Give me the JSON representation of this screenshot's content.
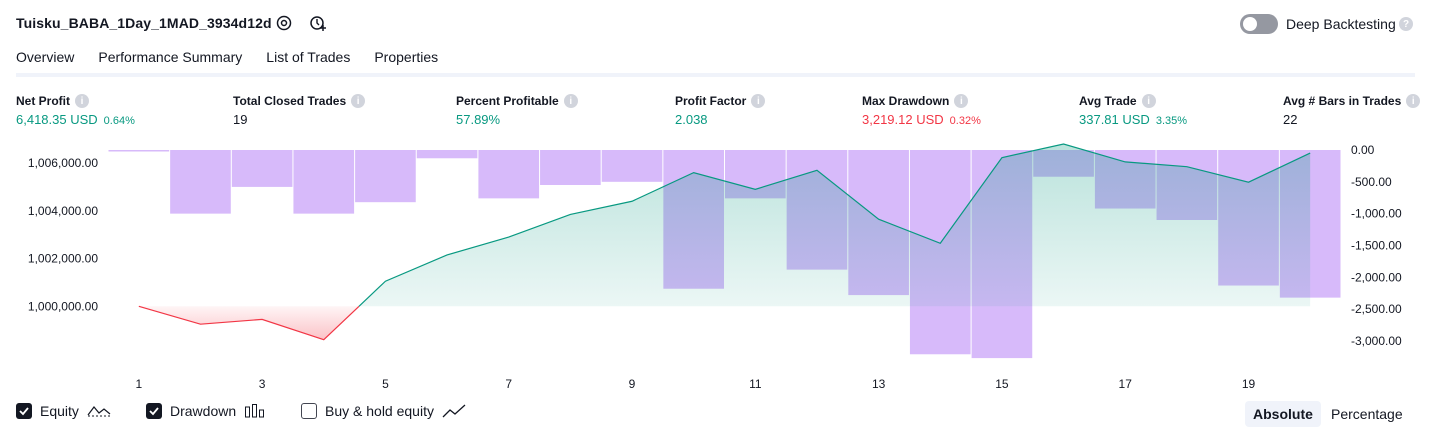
{
  "header": {
    "strategy_name": "Tuisku_BABA_1Day_1MAD_3934d12d",
    "settings_icon": "gear-icon",
    "alert_icon": "add-alert-icon",
    "deep_backtesting_label": "Deep Backtesting",
    "deep_backtesting_enabled": false,
    "help_glyph": "?"
  },
  "tabs": [
    {
      "label": "Overview",
      "active": true
    },
    {
      "label": "Performance Summary",
      "active": false
    },
    {
      "label": "List of Trades",
      "active": false
    },
    {
      "label": "Properties",
      "active": false
    }
  ],
  "metrics": [
    {
      "label": "Net Profit",
      "value": "6,418.35 USD",
      "pct": "0.64%",
      "color": "#089981"
    },
    {
      "label": "Total Closed Trades",
      "value": "19",
      "pct": "",
      "color": "#131722"
    },
    {
      "label": "Percent Profitable",
      "value": "57.89%",
      "pct": "",
      "color": "#089981"
    },
    {
      "label": "Profit Factor",
      "value": "2.038",
      "pct": "",
      "color": "#089981"
    },
    {
      "label": "Max Drawdown",
      "value": "3,219.12 USD",
      "pct": "0.32%",
      "color": "#f23645"
    },
    {
      "label": "Avg Trade",
      "value": "337.81 USD",
      "pct": "3.35%",
      "color": "#089981"
    },
    {
      "label": "Avg # Bars in Trades",
      "value": "22",
      "pct": "",
      "color": "#131722"
    }
  ],
  "info_glyph": "i",
  "chart_data": {
    "type": "line",
    "x": [
      1,
      2,
      3,
      4,
      5,
      6,
      7,
      8,
      9,
      10,
      11,
      12,
      13,
      14,
      15,
      16,
      17,
      18,
      19,
      20
    ],
    "x_tick_labels": [
      "1",
      "3",
      "5",
      "7",
      "9",
      "11",
      "13",
      "15",
      "17",
      "19"
    ],
    "series": [
      {
        "name": "Equity",
        "axis": "left",
        "type": "line",
        "values": [
          1000000,
          999250,
          999450,
          998600,
          1001050,
          1002150,
          1002900,
          1003850,
          1004400,
          1005600,
          1004900,
          1005700,
          1003650,
          1002640,
          1006230,
          1006800,
          1006050,
          1005850,
          1005200,
          1006420
        ],
        "colors": {
          "positive": "#089981",
          "negative": "#f23645"
        }
      },
      {
        "name": "Drawdown",
        "axis": "right",
        "type": "bar",
        "values": [
          0,
          -1000,
          -580,
          -1000,
          -820,
          -130,
          -760,
          -550,
          -500,
          -2180,
          -760,
          -1880,
          -2280,
          -3210,
          -3270,
          -420,
          -920,
          -1100,
          -2130,
          -2320
        ],
        "color": "#c9a3f8"
      }
    ],
    "left_axis": {
      "ticks": [
        "1,006,000.00",
        "1,004,000.00",
        "1,002,000.00",
        "1,000,000.00"
      ],
      "tick_values": [
        1006000,
        1004000,
        1002000,
        1000000
      ],
      "range": [
        998000,
        1006800
      ]
    },
    "right_axis": {
      "ticks": [
        "0.00",
        "-500.00",
        "-1,000.00",
        "-1,500.00",
        "-2,000.00",
        "-2,500.00",
        "-3,000.00"
      ],
      "tick_values": [
        0,
        -500,
        -1000,
        -1500,
        -2000,
        -2500,
        -3000
      ],
      "range": [
        -3300,
        0
      ]
    },
    "baseline": 1000000
  },
  "legend": {
    "equity": {
      "label": "Equity",
      "checked": true,
      "icon": "equity-line-icon"
    },
    "drawdown": {
      "label": "Drawdown",
      "checked": true,
      "icon": "drawdown-bars-icon"
    },
    "buy_hold": {
      "label": "Buy & hold equity",
      "checked": false,
      "icon": "buy-hold-line-icon"
    }
  },
  "scale_toggle": {
    "absolute_label": "Absolute",
    "percentage_label": "Percentage",
    "selected": "Absolute"
  }
}
